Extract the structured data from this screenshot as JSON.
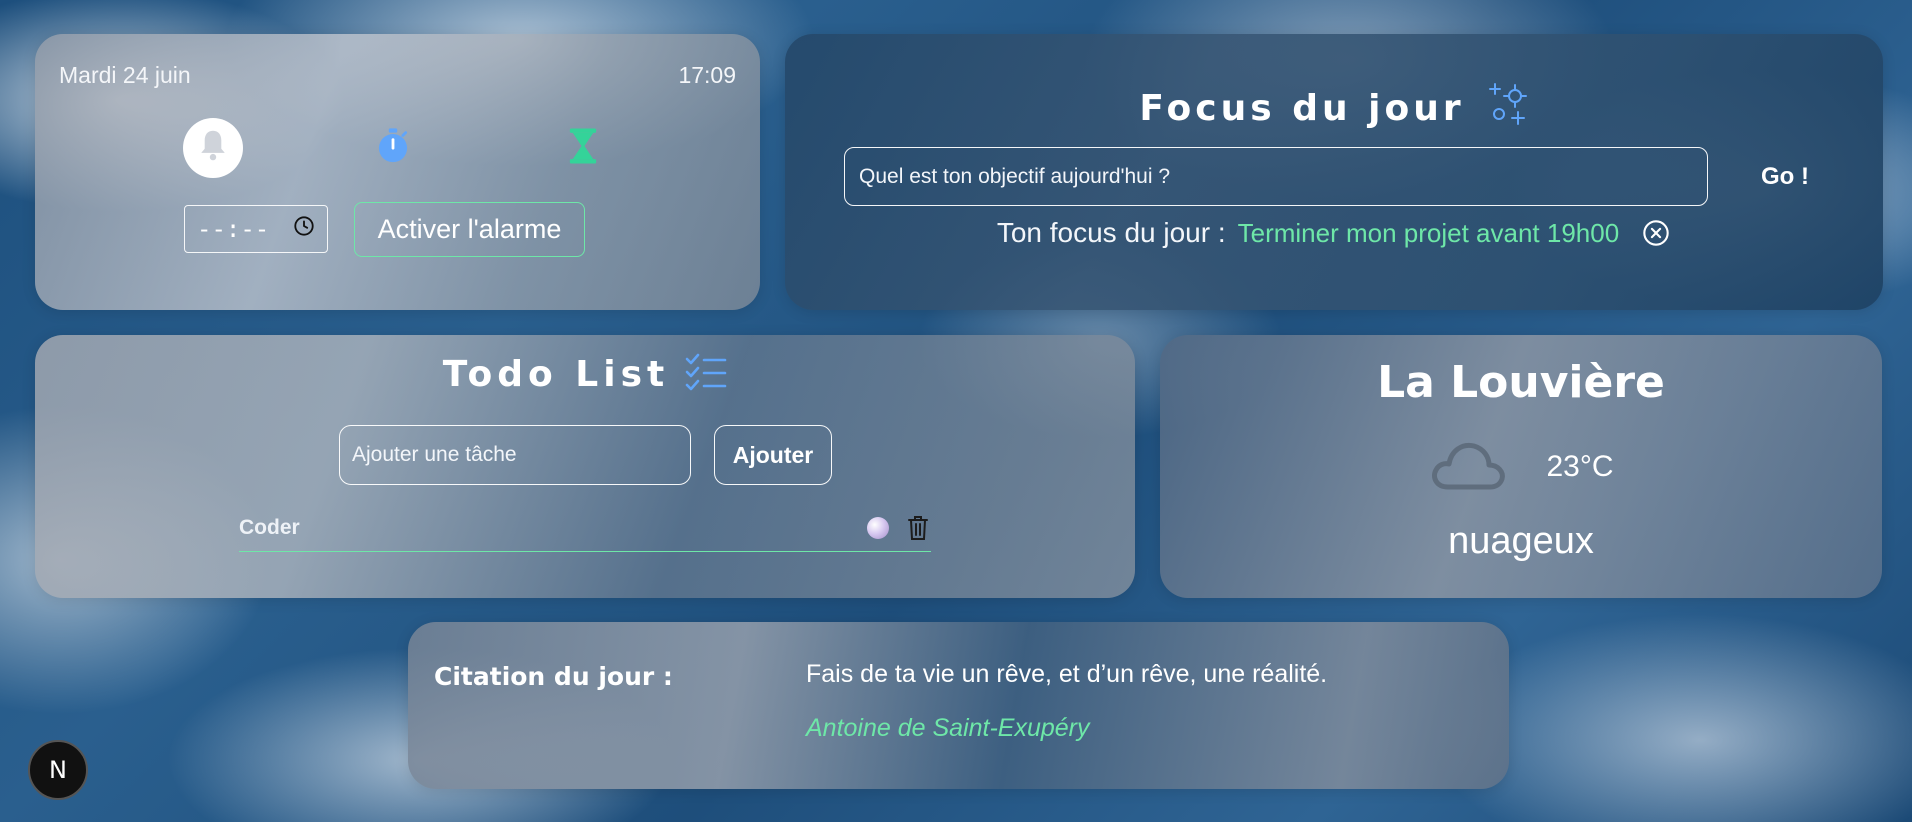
{
  "clock": {
    "date": "Mardi 24 juin",
    "time": "17:09",
    "modes": [
      "bell-icon",
      "stopwatch-icon",
      "hourglass-icon"
    ],
    "time_input_value": "--:--",
    "alarm_button_label": "Activer l'alarme"
  },
  "focus": {
    "title": "Focus du jour",
    "input_placeholder": "Quel est ton objectif aujourd'hui ?",
    "go_label": "Go !",
    "current_label": "Ton focus du jour :",
    "current_value": "Terminer mon projet avant 19h00"
  },
  "todo": {
    "title": "Todo List",
    "input_placeholder": "Ajouter une tâche",
    "add_label": "Ajouter",
    "items": [
      {
        "text": "Coder"
      }
    ]
  },
  "weather": {
    "city": "La Louvière",
    "temperature": "23°C",
    "condition": "nuageux"
  },
  "quote": {
    "label": "Citation du jour :",
    "text": "Fais de ta vie un rêve, et d’un rêve, une réalité.",
    "author": "Antoine de Saint-Exupéry"
  },
  "badge": {
    "letter": "N"
  },
  "colors": {
    "accent_green": "#6ee7a8",
    "icon_blue": "#60a5fa",
    "icon_teal": "#34d399"
  }
}
